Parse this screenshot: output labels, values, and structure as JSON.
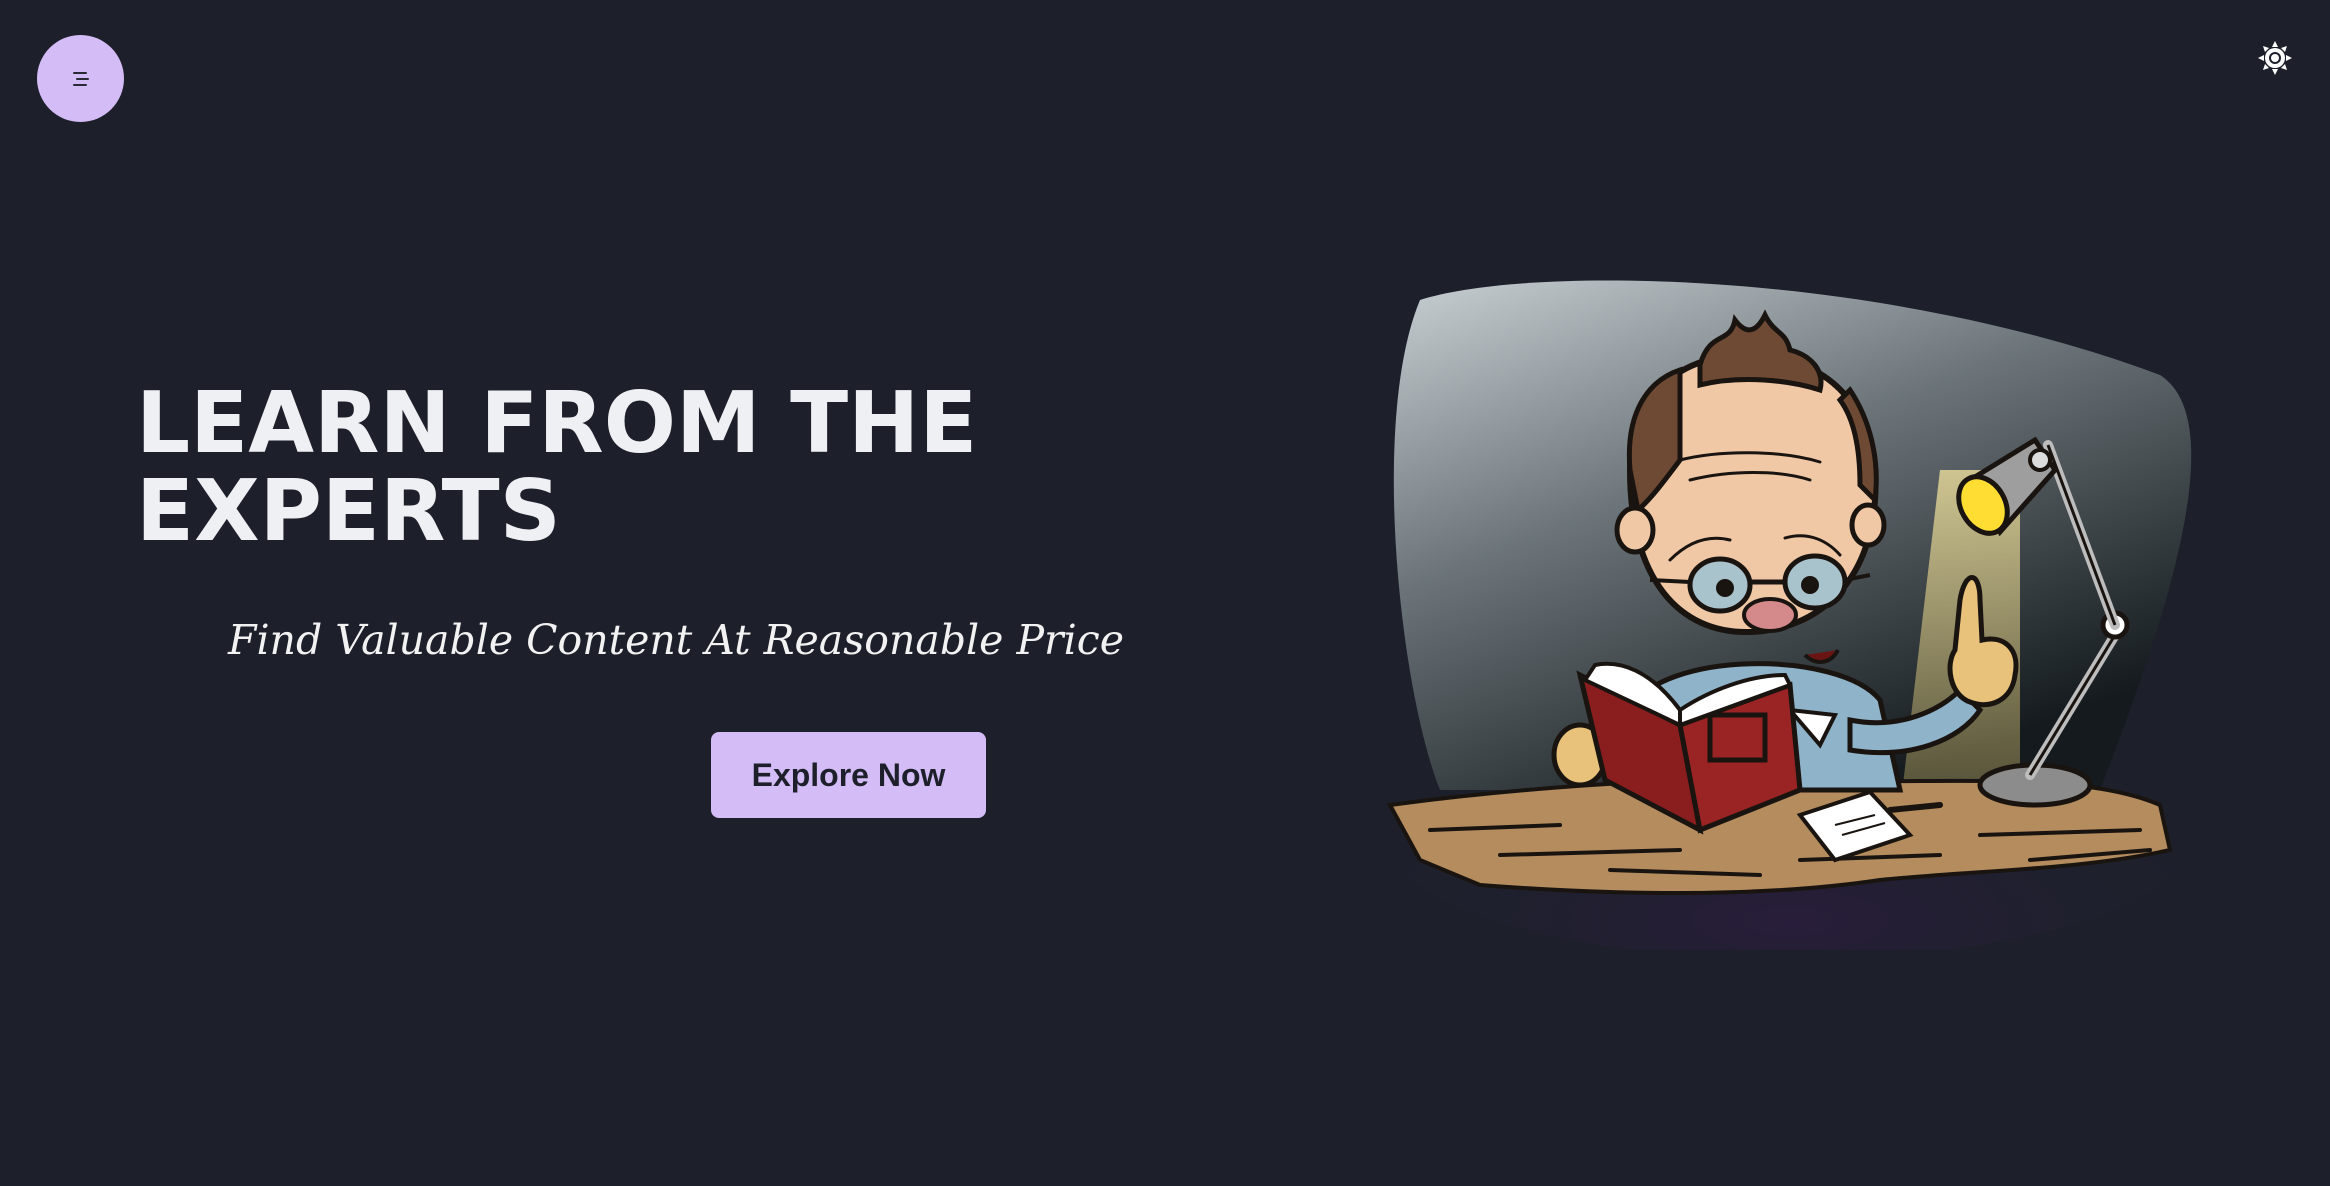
{
  "header": {
    "menu_icon": "menu-lines-icon",
    "theme_icon": "sun-icon"
  },
  "hero": {
    "title_line1": "LEARN FROM THE",
    "title_line2": "EXPERTS",
    "tagline": "Find Valuable Content At Reasonable Price",
    "cta_label": "Explore Now"
  },
  "illustration": {
    "subject": "cartoon-reader-at-desk"
  },
  "colors": {
    "background": "#1d202b",
    "accent": "#d4bdf6",
    "text": "#eef0f3"
  }
}
